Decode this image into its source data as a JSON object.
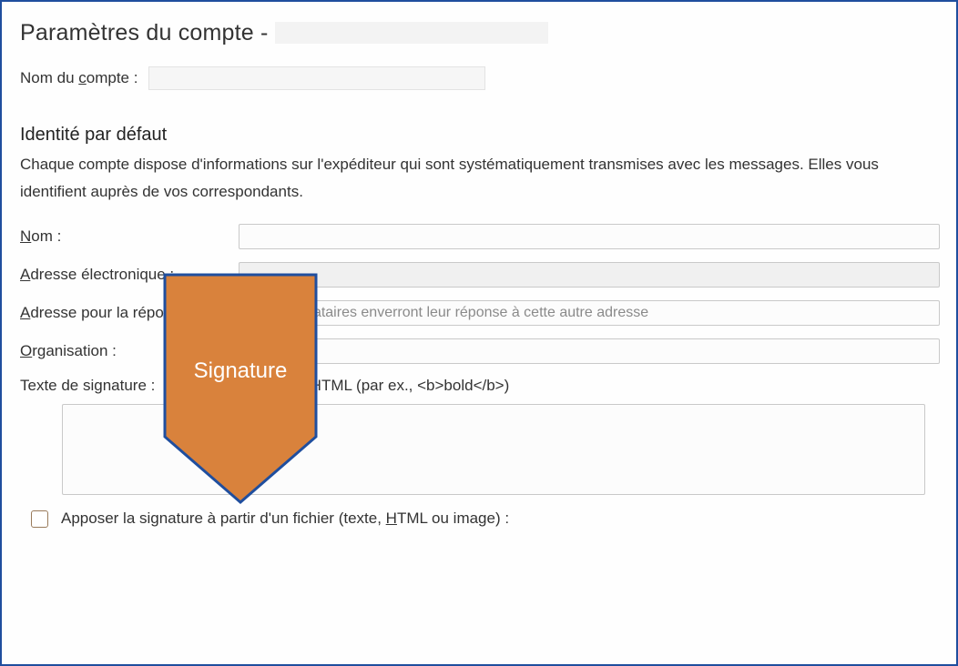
{
  "header": {
    "title_prefix": "Paramètres du compte - "
  },
  "account_name": {
    "label_pre": "Nom du ",
    "label_underlined": "c",
    "label_post": "ompte :"
  },
  "identity": {
    "section_title": "Identité par défaut",
    "description": "Chaque compte dispose d'informations sur l'expéditeur qui sont systématiquement transmises avec les messages. Elles vous identifient auprès de vos correspondants."
  },
  "fields": {
    "name": {
      "u": "N",
      "rest": "om :"
    },
    "email": {
      "u": "A",
      "rest": "dresse électronique :"
    },
    "reply_to": {
      "u": "A",
      "rest": "dresse pour la réponse :",
      "placeholder": "Les destinataires enverront leur réponse à cette autre adresse"
    },
    "org": {
      "u": "O",
      "rest": "rganisation :"
    }
  },
  "signature": {
    "label": "Texte de signature :",
    "hint_u": "U",
    "hint_rest": "tiliser HTML (par ex., <b>bold</b>)",
    "value": ""
  },
  "file_sig": {
    "pre": "Apposer la signature à partir d'un fichier (texte, ",
    "u": "H",
    "post": "TML ou image) :"
  },
  "annotation": {
    "text": "Signature"
  }
}
